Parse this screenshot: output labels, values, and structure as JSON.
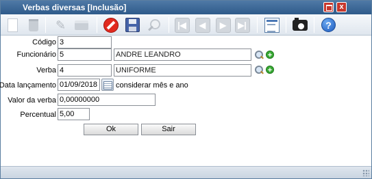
{
  "window": {
    "title": "Verbas diversas [Inclusão]",
    "close_label": "x"
  },
  "toolbar": {
    "items": [
      {
        "icon": "new-document-icon"
      },
      {
        "icon": "trash-icon"
      },
      {
        "icon": "edit-icon"
      },
      {
        "icon": "printer-icon"
      },
      {
        "icon": "cancel-icon"
      },
      {
        "icon": "save-icon"
      },
      {
        "icon": "search-icon"
      },
      {
        "icon": "first-record-icon"
      },
      {
        "icon": "previous-record-icon"
      },
      {
        "icon": "next-record-icon"
      },
      {
        "icon": "last-record-icon"
      },
      {
        "icon": "report-icon"
      },
      {
        "icon": "camera-icon"
      },
      {
        "icon": "help-icon"
      }
    ],
    "help_glyph": "?"
  },
  "form": {
    "codigo": {
      "label": "Código",
      "value": "3"
    },
    "funcionario": {
      "label": "Funcionário",
      "value": "5",
      "name": "ANDRE LEANDRO"
    },
    "verba": {
      "label": "Verba",
      "value": "4",
      "name": "UNIFORME"
    },
    "data_lancamento": {
      "label": "Data lançamento",
      "value": "01/09/2018",
      "note": "considerar mês e ano"
    },
    "valor_verba": {
      "label": "Valor da verba",
      "value": "0,00000000"
    },
    "percentual": {
      "label": "Percentual",
      "value": "5,00"
    }
  },
  "buttons": {
    "ok": "Ok",
    "sair": "Sair"
  },
  "add_glyph": "+"
}
